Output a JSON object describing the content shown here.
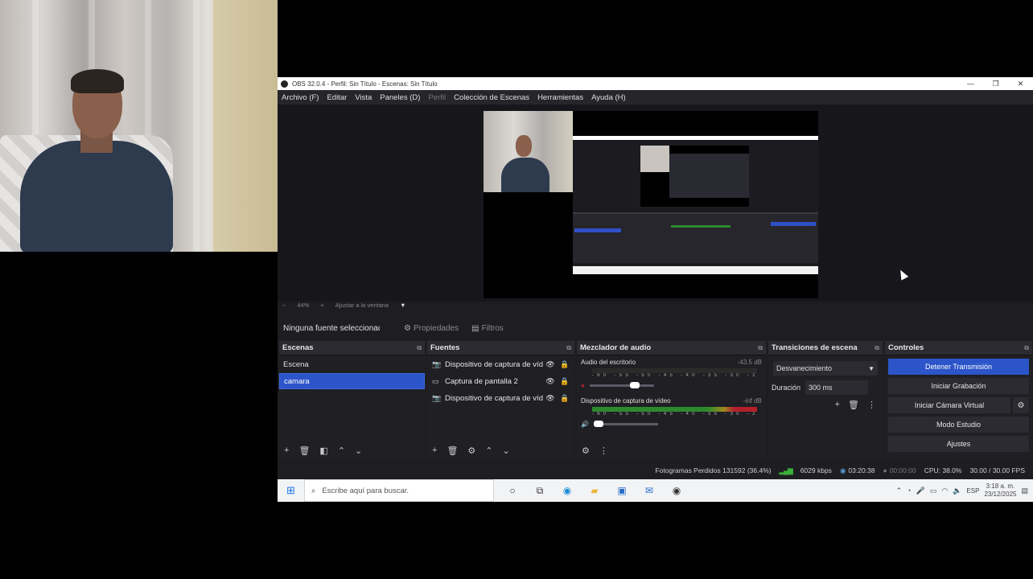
{
  "window": {
    "title": "OBS 32.0.4 - Perfil: Sin Título - Escenas: Sin Título",
    "controls": [
      "—",
      "❐",
      "✕"
    ]
  },
  "menu": {
    "items": [
      "Archivo (F)",
      "Editar",
      "Vista",
      "Paneles (D)",
      "Perfil",
      "Colección de Escenas",
      "Herramientas",
      "Ayuda (H)"
    ]
  },
  "preview": {
    "zoom_minus": "−",
    "zoom": "44%",
    "zoom_plus": "+",
    "fit_label": "Ajustar a la ventana"
  },
  "source_toolbar": {
    "no_source": "Ninguna fuente seleccionada",
    "properties": "Propiedades",
    "filters": "Filtros"
  },
  "scenes": {
    "title": "Escenas",
    "items": [
      "Escena",
      "camara"
    ],
    "selected_index": 1
  },
  "sources": {
    "title": "Fuentes",
    "items": [
      {
        "icon": "camera-icon",
        "label": "Dispositivo de captura de vídeo"
      },
      {
        "icon": "monitor-icon",
        "label": "Captura de pantalla 2"
      },
      {
        "icon": "camera-icon",
        "label": "Dispositivo de captura de vídeo"
      }
    ]
  },
  "mixer": {
    "title": "Mezclador de audio",
    "channels": [
      {
        "name": "Audio del escritorio",
        "db": "-43.5 dB",
        "level": 0.0
      },
      {
        "name": "Dispositivo de captura de vídeo",
        "db": "-inf dB",
        "level": 1.0
      }
    ],
    "ticks": "-60 -55 -50 -45 -40 -35 -30 -25 -20 -15 -10 -5 0"
  },
  "transitions": {
    "title": "Transiciones de escena",
    "selected": "Desvanecimiento",
    "duration_label": "Duración",
    "duration_value": "300 ms"
  },
  "controls": {
    "title": "Controles",
    "stop_stream": "Detener Transmisión",
    "start_recording": "Iniciar Grabación",
    "virtual_cam": "Iniciar Cámara Virtual",
    "studio_mode": "Modo Estudio",
    "settings": "Ajustes"
  },
  "status": {
    "dropped": "Fotogramas Perdidos 131592 (36.4%)",
    "bitrate": "6029 kbps",
    "live_time": "03:20:38",
    "rec_time": "00:00:00",
    "cpu": "CPU: 38.0%",
    "fps": "30.00 / 30.00 FPS"
  },
  "taskbar": {
    "search_placeholder": "Escribe aquí para buscar.",
    "lang": "ESP",
    "time": "3:18 a. m.",
    "date": "23/12/2025"
  },
  "colors": {
    "accent": "#2c55c9",
    "meter_green": "#2c8a2c",
    "meter_red": "#b3202a"
  }
}
